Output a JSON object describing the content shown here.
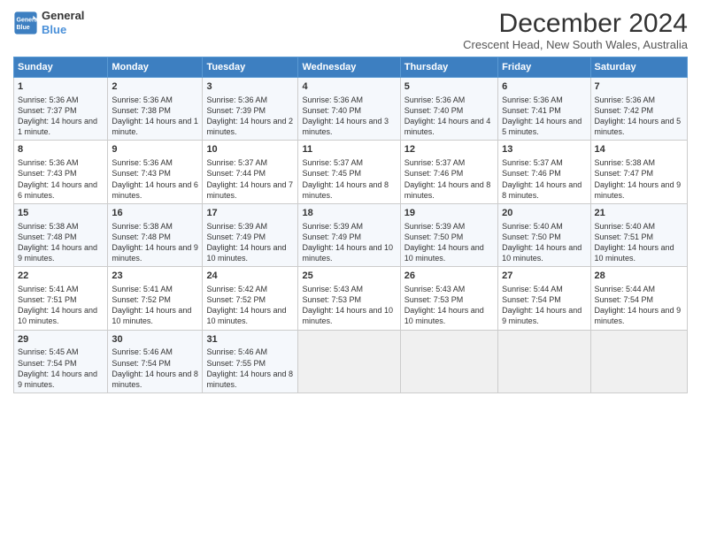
{
  "logo": {
    "line1": "General",
    "line2": "Blue"
  },
  "header": {
    "title": "December 2024",
    "subtitle": "Crescent Head, New South Wales, Australia"
  },
  "columns": [
    "Sunday",
    "Monday",
    "Tuesday",
    "Wednesday",
    "Thursday",
    "Friday",
    "Saturday"
  ],
  "rows": [
    [
      {
        "day": "1",
        "sunrise": "5:36 AM",
        "sunset": "7:37 PM",
        "daylight": "14 hours and 1 minute."
      },
      {
        "day": "2",
        "sunrise": "5:36 AM",
        "sunset": "7:38 PM",
        "daylight": "14 hours and 1 minute."
      },
      {
        "day": "3",
        "sunrise": "5:36 AM",
        "sunset": "7:39 PM",
        "daylight": "14 hours and 2 minutes."
      },
      {
        "day": "4",
        "sunrise": "5:36 AM",
        "sunset": "7:40 PM",
        "daylight": "14 hours and 3 minutes."
      },
      {
        "day": "5",
        "sunrise": "5:36 AM",
        "sunset": "7:40 PM",
        "daylight": "14 hours and 4 minutes."
      },
      {
        "day": "6",
        "sunrise": "5:36 AM",
        "sunset": "7:41 PM",
        "daylight": "14 hours and 5 minutes."
      },
      {
        "day": "7",
        "sunrise": "5:36 AM",
        "sunset": "7:42 PM",
        "daylight": "14 hours and 5 minutes."
      }
    ],
    [
      {
        "day": "8",
        "sunrise": "5:36 AM",
        "sunset": "7:43 PM",
        "daylight": "14 hours and 6 minutes."
      },
      {
        "day": "9",
        "sunrise": "5:36 AM",
        "sunset": "7:43 PM",
        "daylight": "14 hours and 6 minutes."
      },
      {
        "day": "10",
        "sunrise": "5:37 AM",
        "sunset": "7:44 PM",
        "daylight": "14 hours and 7 minutes."
      },
      {
        "day": "11",
        "sunrise": "5:37 AM",
        "sunset": "7:45 PM",
        "daylight": "14 hours and 8 minutes."
      },
      {
        "day": "12",
        "sunrise": "5:37 AM",
        "sunset": "7:46 PM",
        "daylight": "14 hours and 8 minutes."
      },
      {
        "day": "13",
        "sunrise": "5:37 AM",
        "sunset": "7:46 PM",
        "daylight": "14 hours and 8 minutes."
      },
      {
        "day": "14",
        "sunrise": "5:38 AM",
        "sunset": "7:47 PM",
        "daylight": "14 hours and 9 minutes."
      }
    ],
    [
      {
        "day": "15",
        "sunrise": "5:38 AM",
        "sunset": "7:48 PM",
        "daylight": "14 hours and 9 minutes."
      },
      {
        "day": "16",
        "sunrise": "5:38 AM",
        "sunset": "7:48 PM",
        "daylight": "14 hours and 9 minutes."
      },
      {
        "day": "17",
        "sunrise": "5:39 AM",
        "sunset": "7:49 PM",
        "daylight": "14 hours and 10 minutes."
      },
      {
        "day": "18",
        "sunrise": "5:39 AM",
        "sunset": "7:49 PM",
        "daylight": "14 hours and 10 minutes."
      },
      {
        "day": "19",
        "sunrise": "5:39 AM",
        "sunset": "7:50 PM",
        "daylight": "14 hours and 10 minutes."
      },
      {
        "day": "20",
        "sunrise": "5:40 AM",
        "sunset": "7:50 PM",
        "daylight": "14 hours and 10 minutes."
      },
      {
        "day": "21",
        "sunrise": "5:40 AM",
        "sunset": "7:51 PM",
        "daylight": "14 hours and 10 minutes."
      }
    ],
    [
      {
        "day": "22",
        "sunrise": "5:41 AM",
        "sunset": "7:51 PM",
        "daylight": "14 hours and 10 minutes."
      },
      {
        "day": "23",
        "sunrise": "5:41 AM",
        "sunset": "7:52 PM",
        "daylight": "14 hours and 10 minutes."
      },
      {
        "day": "24",
        "sunrise": "5:42 AM",
        "sunset": "7:52 PM",
        "daylight": "14 hours and 10 minutes."
      },
      {
        "day": "25",
        "sunrise": "5:43 AM",
        "sunset": "7:53 PM",
        "daylight": "14 hours and 10 minutes."
      },
      {
        "day": "26",
        "sunrise": "5:43 AM",
        "sunset": "7:53 PM",
        "daylight": "14 hours and 10 minutes."
      },
      {
        "day": "27",
        "sunrise": "5:44 AM",
        "sunset": "7:54 PM",
        "daylight": "14 hours and 9 minutes."
      },
      {
        "day": "28",
        "sunrise": "5:44 AM",
        "sunset": "7:54 PM",
        "daylight": "14 hours and 9 minutes."
      }
    ],
    [
      {
        "day": "29",
        "sunrise": "5:45 AM",
        "sunset": "7:54 PM",
        "daylight": "14 hours and 9 minutes."
      },
      {
        "day": "30",
        "sunrise": "5:46 AM",
        "sunset": "7:54 PM",
        "daylight": "14 hours and 8 minutes."
      },
      {
        "day": "31",
        "sunrise": "5:46 AM",
        "sunset": "7:55 PM",
        "daylight": "14 hours and 8 minutes."
      },
      null,
      null,
      null,
      null
    ]
  ],
  "labels": {
    "sunrise": "Sunrise:",
    "sunset": "Sunset:",
    "daylight": "Daylight:"
  }
}
